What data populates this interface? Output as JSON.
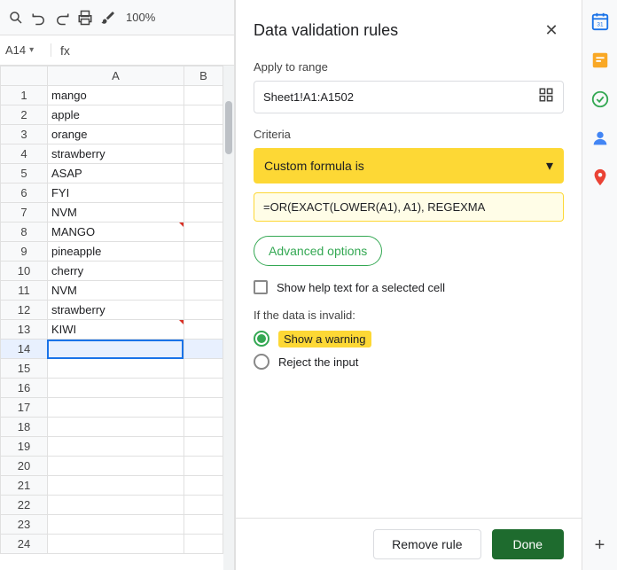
{
  "toolbar": {
    "zoom": "100%"
  },
  "formula_bar": {
    "cell_ref": "A14",
    "formula_icon": "fx"
  },
  "grid": {
    "col_headers": [
      "",
      "A",
      "B"
    ],
    "rows": [
      {
        "num": 1,
        "a": "mango",
        "b": "",
        "red": false
      },
      {
        "num": 2,
        "a": "apple",
        "b": "",
        "red": false
      },
      {
        "num": 3,
        "a": "orange",
        "b": "",
        "red": false
      },
      {
        "num": 4,
        "a": "strawberry",
        "b": "",
        "red": false
      },
      {
        "num": 5,
        "a": "ASAP",
        "b": "",
        "red": false
      },
      {
        "num": 6,
        "a": "FYI",
        "b": "",
        "red": false
      },
      {
        "num": 7,
        "a": "NVM",
        "b": "",
        "red": false
      },
      {
        "num": 8,
        "a": "MANGO",
        "b": "",
        "red": true
      },
      {
        "num": 9,
        "a": "pineapple",
        "b": "",
        "red": false
      },
      {
        "num": 10,
        "a": "cherry",
        "b": "",
        "red": false
      },
      {
        "num": 11,
        "a": "NVM",
        "b": "",
        "red": false
      },
      {
        "num": 12,
        "a": "strawberry",
        "b": "",
        "red": false
      },
      {
        "num": 13,
        "a": "KIWI",
        "b": "",
        "red": true
      },
      {
        "num": 14,
        "a": "",
        "b": "",
        "red": false,
        "selected": true
      },
      {
        "num": 15,
        "a": "",
        "b": "",
        "red": false
      },
      {
        "num": 16,
        "a": "",
        "b": "",
        "red": false
      },
      {
        "num": 17,
        "a": "",
        "b": "",
        "red": false
      },
      {
        "num": 18,
        "a": "",
        "b": "",
        "red": false
      },
      {
        "num": 19,
        "a": "",
        "b": "",
        "red": false
      },
      {
        "num": 20,
        "a": "",
        "b": "",
        "red": false
      },
      {
        "num": 21,
        "a": "",
        "b": "",
        "red": false
      },
      {
        "num": 22,
        "a": "",
        "b": "",
        "red": false
      },
      {
        "num": 23,
        "a": "",
        "b": "",
        "red": false
      },
      {
        "num": 24,
        "a": "",
        "b": "",
        "red": false
      }
    ]
  },
  "panel": {
    "title": "Data validation rules",
    "apply_label": "Apply to range",
    "range_value": "Sheet1!A1:A1502",
    "criteria_label": "Criteria",
    "criteria_dropdown": "Custom formula is",
    "formula_value": "=OR(EXACT(LOWER(A1), A1), REGEXMA",
    "advanced_options_label": "Advanced options",
    "help_text_checkbox": "Show help text for a selected cell",
    "invalid_data_label": "If the data is invalid:",
    "show_warning_label": "Show a warning",
    "reject_input_label": "Reject the input",
    "remove_rule_btn": "Remove rule",
    "done_btn": "Done"
  }
}
